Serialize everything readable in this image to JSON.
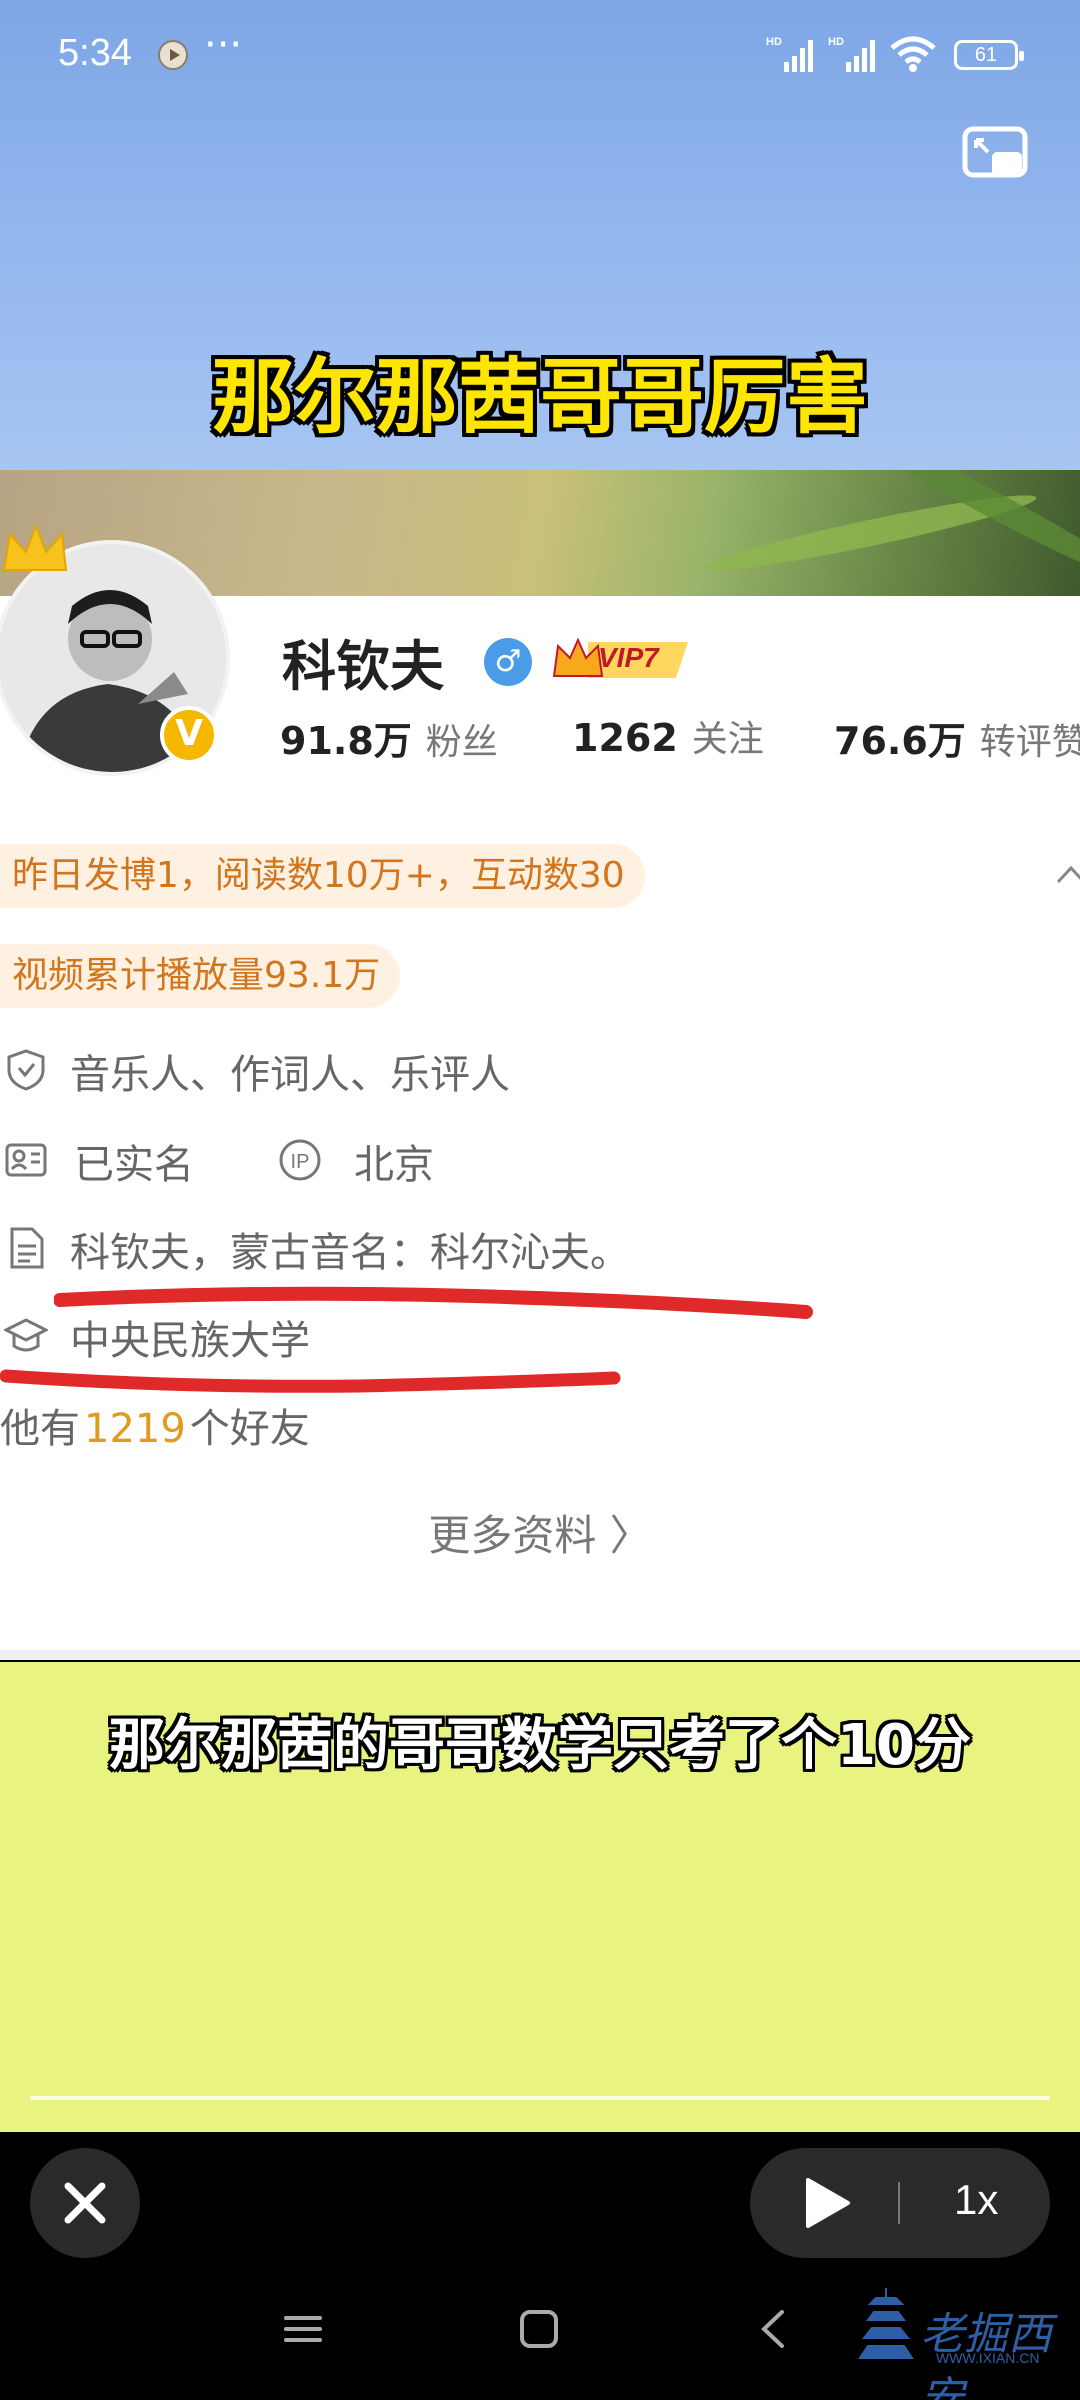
{
  "status_bar": {
    "time": "5:34",
    "battery": "61",
    "signal1_label": "HD",
    "signal2_label": "HD"
  },
  "video": {
    "caption_top": "那尔那茜哥哥厉害",
    "caption_bottom": "那尔那茜的哥哥数学只考了个10分"
  },
  "profile": {
    "name": "科钦夫",
    "gender_symbol": "♂",
    "vip_label": "VIP7",
    "verified_symbol": "V",
    "stats": [
      {
        "num": "91.8万",
        "label": "粉丝"
      },
      {
        "num": "1262",
        "label": "关注"
      },
      {
        "num": "76.6万",
        "label": "转评赞"
      }
    ],
    "highlights": [
      "昨日发博1，阅读数10万+，互动数30",
      "视频累计播放量93.1万"
    ],
    "occupation": "音乐人、作词人、乐评人",
    "real_name": "已实名",
    "ip_badge": "IP",
    "location": "北京",
    "bio": "科钦夫，蒙古音名：科尔沁夫。",
    "school": "中央民族大学",
    "friends_prefix": "他有",
    "friends_count": "1219",
    "friends_suffix": "个好友",
    "more_info": "更多资料 〉"
  },
  "player": {
    "speed": "1x"
  },
  "watermark": {
    "text": "老掘西安",
    "sub": "WWW.IXIAN.CN"
  },
  "colors": {
    "caption_yellow": "#ffe600",
    "highlight_orange": "#d2761e",
    "underline_red": "#e02a2a",
    "lower_bg": "#e8f47f"
  }
}
